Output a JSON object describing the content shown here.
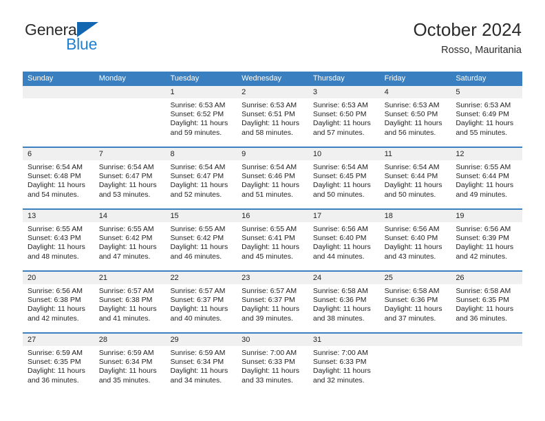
{
  "brand": {
    "name_top": "General",
    "name_bottom": "Blue",
    "triangle_color": "#1367b0",
    "top_color": "#2b2b2b",
    "bottom_color": "#1f7fd0"
  },
  "header": {
    "title": "October 2024",
    "subtitle": "Rosso, Mauritania"
  },
  "theme": {
    "header_blue": "#3a7fbf",
    "daynum_band": "#f0f0f0",
    "text": "#222222"
  },
  "calendar": {
    "weekday_headers": [
      "Sunday",
      "Monday",
      "Tuesday",
      "Wednesday",
      "Thursday",
      "Friday",
      "Saturday"
    ],
    "weeks": [
      {
        "numbers": [
          "",
          "",
          "1",
          "2",
          "3",
          "4",
          "5"
        ],
        "cells": [
          {
            "lines": []
          },
          {
            "lines": []
          },
          {
            "lines": [
              "Sunrise: 6:53 AM",
              "Sunset: 6:52 PM",
              "Daylight: 11 hours",
              "and 59 minutes."
            ]
          },
          {
            "lines": [
              "Sunrise: 6:53 AM",
              "Sunset: 6:51 PM",
              "Daylight: 11 hours",
              "and 58 minutes."
            ]
          },
          {
            "lines": [
              "Sunrise: 6:53 AM",
              "Sunset: 6:50 PM",
              "Daylight: 11 hours",
              "and 57 minutes."
            ]
          },
          {
            "lines": [
              "Sunrise: 6:53 AM",
              "Sunset: 6:50 PM",
              "Daylight: 11 hours",
              "and 56 minutes."
            ]
          },
          {
            "lines": [
              "Sunrise: 6:53 AM",
              "Sunset: 6:49 PM",
              "Daylight: 11 hours",
              "and 55 minutes."
            ]
          }
        ]
      },
      {
        "numbers": [
          "6",
          "7",
          "8",
          "9",
          "10",
          "11",
          "12"
        ],
        "cells": [
          {
            "lines": [
              "Sunrise: 6:54 AM",
              "Sunset: 6:48 PM",
              "Daylight: 11 hours",
              "and 54 minutes."
            ]
          },
          {
            "lines": [
              "Sunrise: 6:54 AM",
              "Sunset: 6:47 PM",
              "Daylight: 11 hours",
              "and 53 minutes."
            ]
          },
          {
            "lines": [
              "Sunrise: 6:54 AM",
              "Sunset: 6:47 PM",
              "Daylight: 11 hours",
              "and 52 minutes."
            ]
          },
          {
            "lines": [
              "Sunrise: 6:54 AM",
              "Sunset: 6:46 PM",
              "Daylight: 11 hours",
              "and 51 minutes."
            ]
          },
          {
            "lines": [
              "Sunrise: 6:54 AM",
              "Sunset: 6:45 PM",
              "Daylight: 11 hours",
              "and 50 minutes."
            ]
          },
          {
            "lines": [
              "Sunrise: 6:54 AM",
              "Sunset: 6:44 PM",
              "Daylight: 11 hours",
              "and 50 minutes."
            ]
          },
          {
            "lines": [
              "Sunrise: 6:55 AM",
              "Sunset: 6:44 PM",
              "Daylight: 11 hours",
              "and 49 minutes."
            ]
          }
        ]
      },
      {
        "numbers": [
          "13",
          "14",
          "15",
          "16",
          "17",
          "18",
          "19"
        ],
        "cells": [
          {
            "lines": [
              "Sunrise: 6:55 AM",
              "Sunset: 6:43 PM",
              "Daylight: 11 hours",
              "and 48 minutes."
            ]
          },
          {
            "lines": [
              "Sunrise: 6:55 AM",
              "Sunset: 6:42 PM",
              "Daylight: 11 hours",
              "and 47 minutes."
            ]
          },
          {
            "lines": [
              "Sunrise: 6:55 AM",
              "Sunset: 6:42 PM",
              "Daylight: 11 hours",
              "and 46 minutes."
            ]
          },
          {
            "lines": [
              "Sunrise: 6:55 AM",
              "Sunset: 6:41 PM",
              "Daylight: 11 hours",
              "and 45 minutes."
            ]
          },
          {
            "lines": [
              "Sunrise: 6:56 AM",
              "Sunset: 6:40 PM",
              "Daylight: 11 hours",
              "and 44 minutes."
            ]
          },
          {
            "lines": [
              "Sunrise: 6:56 AM",
              "Sunset: 6:40 PM",
              "Daylight: 11 hours",
              "and 43 minutes."
            ]
          },
          {
            "lines": [
              "Sunrise: 6:56 AM",
              "Sunset: 6:39 PM",
              "Daylight: 11 hours",
              "and 42 minutes."
            ]
          }
        ]
      },
      {
        "numbers": [
          "20",
          "21",
          "22",
          "23",
          "24",
          "25",
          "26"
        ],
        "cells": [
          {
            "lines": [
              "Sunrise: 6:56 AM",
              "Sunset: 6:38 PM",
              "Daylight: 11 hours",
              "and 42 minutes."
            ]
          },
          {
            "lines": [
              "Sunrise: 6:57 AM",
              "Sunset: 6:38 PM",
              "Daylight: 11 hours",
              "and 41 minutes."
            ]
          },
          {
            "lines": [
              "Sunrise: 6:57 AM",
              "Sunset: 6:37 PM",
              "Daylight: 11 hours",
              "and 40 minutes."
            ]
          },
          {
            "lines": [
              "Sunrise: 6:57 AM",
              "Sunset: 6:37 PM",
              "Daylight: 11 hours",
              "and 39 minutes."
            ]
          },
          {
            "lines": [
              "Sunrise: 6:58 AM",
              "Sunset: 6:36 PM",
              "Daylight: 11 hours",
              "and 38 minutes."
            ]
          },
          {
            "lines": [
              "Sunrise: 6:58 AM",
              "Sunset: 6:36 PM",
              "Daylight: 11 hours",
              "and 37 minutes."
            ]
          },
          {
            "lines": [
              "Sunrise: 6:58 AM",
              "Sunset: 6:35 PM",
              "Daylight: 11 hours",
              "and 36 minutes."
            ]
          }
        ]
      },
      {
        "numbers": [
          "27",
          "28",
          "29",
          "30",
          "31",
          "",
          ""
        ],
        "cells": [
          {
            "lines": [
              "Sunrise: 6:59 AM",
              "Sunset: 6:35 PM",
              "Daylight: 11 hours",
              "and 36 minutes."
            ]
          },
          {
            "lines": [
              "Sunrise: 6:59 AM",
              "Sunset: 6:34 PM",
              "Daylight: 11 hours",
              "and 35 minutes."
            ]
          },
          {
            "lines": [
              "Sunrise: 6:59 AM",
              "Sunset: 6:34 PM",
              "Daylight: 11 hours",
              "and 34 minutes."
            ]
          },
          {
            "lines": [
              "Sunrise: 7:00 AM",
              "Sunset: 6:33 PM",
              "Daylight: 11 hours",
              "and 33 minutes."
            ]
          },
          {
            "lines": [
              "Sunrise: 7:00 AM",
              "Sunset: 6:33 PM",
              "Daylight: 11 hours",
              "and 32 minutes."
            ]
          },
          {
            "lines": []
          },
          {
            "lines": []
          }
        ]
      }
    ]
  }
}
